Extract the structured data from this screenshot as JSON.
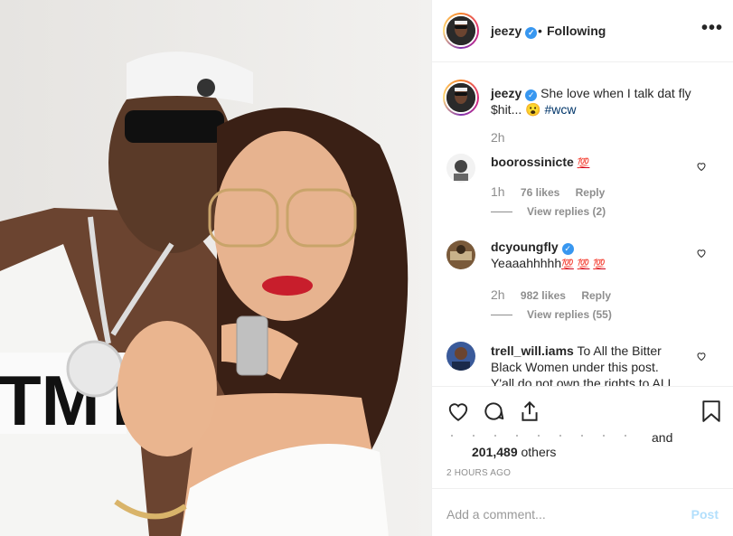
{
  "post": {
    "username": "jeezy",
    "follow_state": "Following",
    "separator": "•",
    "more_label": "•••",
    "verified_glyph": "✓",
    "accent": "#3897f0",
    "caption": {
      "username": "jeezy",
      "text_line1": "She love when I talk dat fly",
      "text_line2": "$hit...",
      "emoji": "😮",
      "hashtag": "#wcw",
      "time": "2h"
    },
    "comments": [
      {
        "username": "boorossinicte",
        "text": "",
        "emoji": "💯",
        "time": "1h",
        "likes": "76 likes",
        "reply": "Reply",
        "view_replies": "View replies (2)"
      },
      {
        "username": "dcyoungfly",
        "text": "Yeaaahhhhh",
        "emoji": [
          "💯",
          "💯",
          "💯"
        ],
        "time": "2h",
        "likes": "982 likes",
        "reply": "Reply",
        "view_replies": "View replies (55)"
      },
      {
        "username": "trell_will.iams",
        "text_line1": "To All the Bitter",
        "text_line2": "Black Women under this post.",
        "text_line3": "Y'all do not own the rights to ALL"
      }
    ],
    "likes": {
      "and": "and",
      "count": "201,489",
      "others": "others"
    },
    "timestamp": "2 HOURS AGO",
    "add_comment_placeholder": "Add a comment...",
    "post_button": "Post",
    "icons": [
      "heart-icon",
      "comment-icon",
      "share-icon",
      "bookmark-icon",
      "more-icon"
    ]
  }
}
